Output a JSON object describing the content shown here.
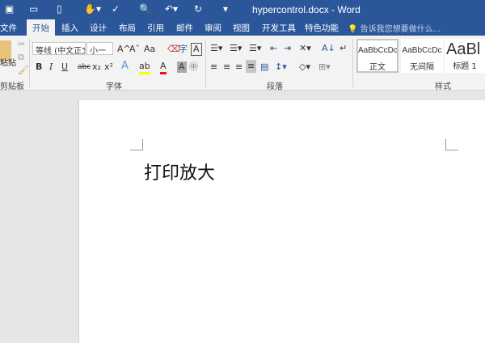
{
  "window": {
    "title": "hypercontrol.docx - Word"
  },
  "quick_access": [
    "save-icon",
    "open-icon",
    "new-icon",
    "touch-mode-icon",
    "spelling-icon",
    "print-preview-icon",
    "undo-icon",
    "redo-icon",
    "customize-icon"
  ],
  "tabs": [
    {
      "label": "文件"
    },
    {
      "label": "开始"
    },
    {
      "label": "插入"
    },
    {
      "label": "设计"
    },
    {
      "label": "布局"
    },
    {
      "label": "引用"
    },
    {
      "label": "邮件"
    },
    {
      "label": "审阅"
    },
    {
      "label": "视图"
    },
    {
      "label": "开发工具"
    },
    {
      "label": "特色功能"
    }
  ],
  "tell_me": "告诉我您想要做什么...",
  "clipboard": {
    "paste": "粘贴",
    "label": "剪贴板"
  },
  "font": {
    "name": "等线 (中文正文",
    "size": "小一",
    "label": "字体",
    "bold": "B",
    "italic": "I",
    "underline": "U",
    "strike": "abc",
    "sub": "x₂",
    "sup": "x²",
    "grow": "A^",
    "shrink": "Aˇ",
    "case": "Aa",
    "font_color_hex": "#e81123",
    "highlight_hex": "#ffff00"
  },
  "paragraph": {
    "label": "段落"
  },
  "styles": {
    "label": "样式",
    "items": [
      {
        "preview": "AaBbCcDc",
        "name": "正文"
      },
      {
        "preview": "AaBbCcDc",
        "name": "无间隔"
      },
      {
        "preview": "AaBl",
        "name": "标题 1"
      }
    ]
  },
  "document": {
    "text": "打印放大"
  }
}
